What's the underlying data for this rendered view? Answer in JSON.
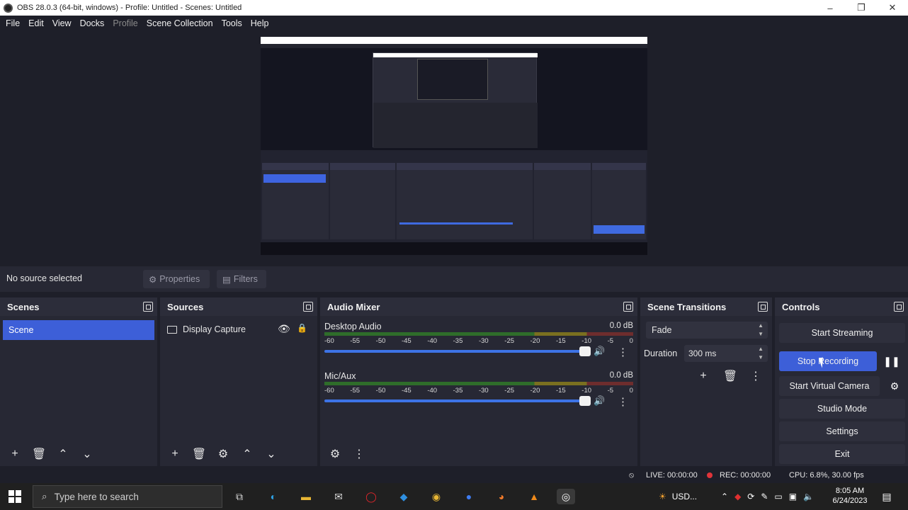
{
  "window": {
    "title": "OBS 28.0.3 (64-bit, windows) - Profile: Untitled - Scenes: Untitled"
  },
  "menu": [
    "File",
    "Edit",
    "View",
    "Docks",
    "Profile",
    "Scene Collection",
    "Tools",
    "Help"
  ],
  "sourcebar": {
    "no_source": "No source selected",
    "properties": "Properties",
    "filters": "Filters"
  },
  "scenes": {
    "title": "Scenes",
    "items": [
      "Scene"
    ]
  },
  "sources": {
    "title": "Sources",
    "items": [
      "Display Capture"
    ]
  },
  "audio_mixer": {
    "title": "Audio Mixer",
    "ticks": [
      "-60",
      "-55",
      "-50",
      "-45",
      "-40",
      "-35",
      "-30",
      "-25",
      "-20",
      "-15",
      "-10",
      "-5",
      "0"
    ],
    "channels": [
      {
        "name": "Desktop Audio",
        "db": "0.0 dB"
      },
      {
        "name": "Mic/Aux",
        "db": "0.0 dB"
      }
    ]
  },
  "transitions": {
    "title": "Scene Transitions",
    "selected": "Fade",
    "duration_label": "Duration",
    "duration_value": "300 ms"
  },
  "controls": {
    "title": "Controls",
    "start_streaming": "Start Streaming",
    "stop_recording": "Stop Recording",
    "start_virtual_camera": "Start Virtual Camera",
    "studio_mode": "Studio Mode",
    "settings": "Settings",
    "exit": "Exit"
  },
  "status": {
    "live": "LIVE: 00:00:00",
    "rec": "REC: 00:00:00",
    "cpu": "CPU: 6.8%, 30.00 fps"
  },
  "taskbar": {
    "search_placeholder": "Type here to search",
    "tray_label": "USD...",
    "time": "8:05 AM",
    "date": "6/24/2023"
  },
  "colors": {
    "accent": "#3d5fd8",
    "background": "#1e1f29",
    "dock": "#272834",
    "record_dot": "#e0343a"
  }
}
